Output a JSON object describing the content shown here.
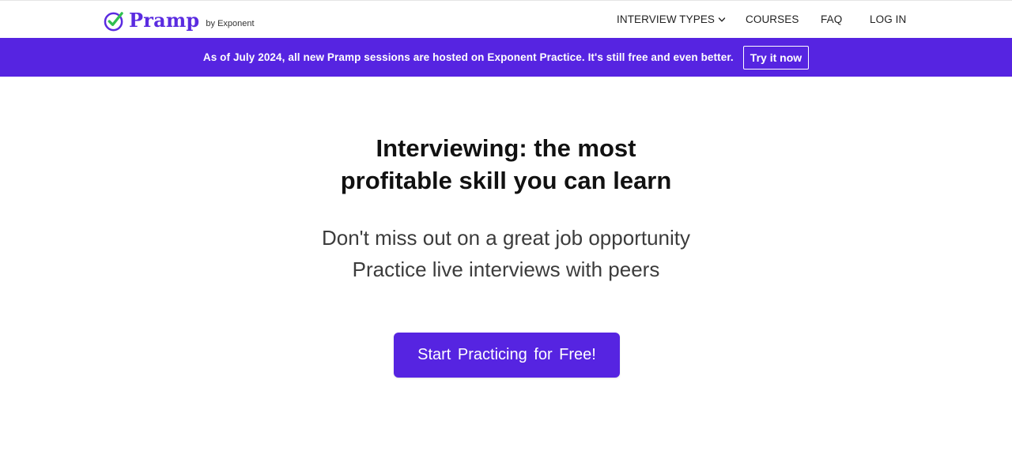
{
  "header": {
    "brand": {
      "name": "Pramp",
      "byline": "by Exponent",
      "icon": "check-circle-icon",
      "colors": {
        "ring": "#5a2be0",
        "check": "#2fbf4f"
      }
    },
    "nav": {
      "interview_types": "INTERVIEW TYPES",
      "courses": "COURSES",
      "faq": "FAQ",
      "login": "LOG IN"
    }
  },
  "banner": {
    "text": "As of July 2024, all new Pramp sessions are hosted on Exponent Practice. It's still free and even better.",
    "button_label": "Try it now",
    "background": "#5624e1"
  },
  "hero": {
    "title_line1": "Interviewing: the most",
    "title_line2": "profitable skill you can learn",
    "subtitle_line1": "Don't miss out on a great job opportunity",
    "subtitle_line2": "Practice live interviews with peers",
    "cta_label": "Start Practicing for Free!"
  },
  "theme": {
    "accent": "#5624e1"
  }
}
